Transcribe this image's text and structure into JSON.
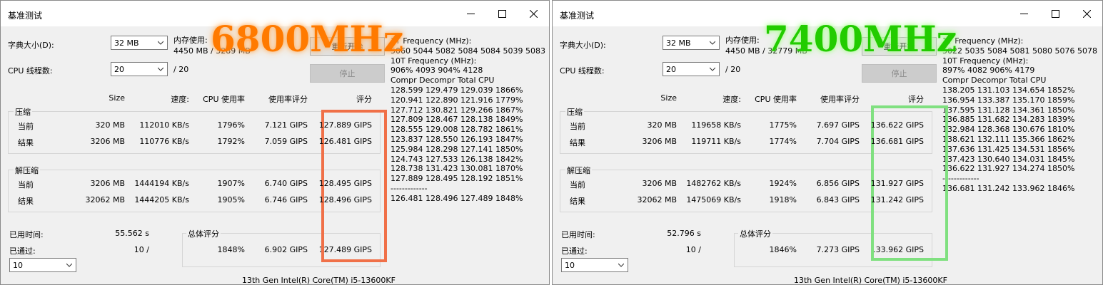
{
  "windows": [
    {
      "title": "基准测试",
      "overlay_text": "6800MHz",
      "overlay_color": "#ff7a00",
      "highlight_color": "#f07048",
      "dict_label": "字典大小(D):",
      "dict_value": "32 MB",
      "threads_label": "CPU 线程数:",
      "threads_value": "20",
      "threads_max": "/ 20",
      "memory_label": "内存使用:",
      "memory_value": "4450 MB / 3289 MB",
      "restart_button": "重新开始",
      "stop_button": "停止",
      "headers": {
        "size": "Size",
        "speed": "速度:",
        "cpu": "CPU 使用率",
        "rating": "使用率评分",
        "score": "评分"
      },
      "compress_label": "压缩",
      "decompress_label": "解压缩",
      "compress_current": {
        "label": "当前",
        "size": "320 MB",
        "speed": "112010 KB/s",
        "cpu": "1796%",
        "rating": "7.121 GIPS",
        "score": "127.889 GIPS"
      },
      "compress_result": {
        "label": "结果",
        "size": "3206 MB",
        "speed": "110776 KB/s",
        "cpu": "1792%",
        "rating": "7.059 GIPS",
        "score": "126.481 GIPS"
      },
      "decompress_current": {
        "label": "当前",
        "size": "3206 MB",
        "speed": "1444194 KB/s",
        "cpu": "1907%",
        "rating": "6.740 GIPS",
        "score": "128.495 GIPS"
      },
      "decompress_result": {
        "label": "结果",
        "size": "32062 MB",
        "speed": "1444205 KB/s",
        "cpu": "1905%",
        "rating": "6.746 GIPS",
        "score": "128.496 GIPS"
      },
      "elapsed_label": "已用时间:",
      "elapsed_value": "55.562 s",
      "passed_label": "已通过:",
      "passed_value": "10 /",
      "passes_select": "10",
      "total_label": "总体评分",
      "total_cpu": "1848%",
      "total_rating": "6.902 GIPS",
      "total_score": "127.489 GIPS",
      "cpu_name": "13th Gen Intel(R) Core(TM) i5-13600KF",
      "log_lines": [
        "1T Frequency (MHz):",
        " 5060 5044 5082 5084 5084 5039 5083",
        "10T Frequency (MHz):",
        " 906% 4093 904% 4128",
        "Compr Decompr Total   CPU",
        "128.599  129.479  129.039  1866%",
        "120.941  122.890  121.916  1779%",
        "127.712  130.821  129.266  1867%",
        "127.809  128.467  128.138  1849%",
        "128.555  129.008  128.782  1861%",
        "123.837  128.550  126.193  1847%",
        "125.984  128.298  127.141  1850%",
        "124.743  127.533  126.138  1842%",
        "128.738  131.423  130.081  1870%",
        "127.889  128.495  128.192  1851%",
        "-------------",
        "126.481  128.496  127.489  1848%"
      ]
    },
    {
      "title": "基准测试",
      "overlay_text": "7400MHz",
      "overlay_color": "#22cc00",
      "highlight_color": "#80e080",
      "dict_label": "字典大小(D):",
      "dict_value": "32 MB",
      "threads_label": "CPU 线程数:",
      "threads_value": "20",
      "threads_max": "/ 20",
      "memory_label": "内存使用:",
      "memory_value": "4450 MB / 32779 MB",
      "restart_button": "重新开始",
      "stop_button": "停止",
      "headers": {
        "size": "Size",
        "speed": "速度:",
        "cpu": "CPU 使用率",
        "rating": "使用率评分",
        "score": "评分"
      },
      "compress_label": "压缩",
      "decompress_label": "解压缩",
      "compress_current": {
        "label": "当前",
        "size": "320 MB",
        "speed": "119658 KB/s",
        "cpu": "1775%",
        "rating": "7.697 GIPS",
        "score": "136.622 GIPS"
      },
      "compress_result": {
        "label": "结果",
        "size": "3206 MB",
        "speed": "119711 KB/s",
        "cpu": "1774%",
        "rating": "7.704 GIPS",
        "score": "136.681 GIPS"
      },
      "decompress_current": {
        "label": "当前",
        "size": "3206 MB",
        "speed": "1482762 KB/s",
        "cpu": "1924%",
        "rating": "6.856 GIPS",
        "score": "131.927 GIPS"
      },
      "decompress_result": {
        "label": "结果",
        "size": "32062 MB",
        "speed": "1475069 KB/s",
        "cpu": "1918%",
        "rating": "6.843 GIPS",
        "score": "131.242 GIPS"
      },
      "elapsed_label": "已用时间:",
      "elapsed_value": "52.796 s",
      "passed_label": "已通过:",
      "passed_value": "10 /",
      "passes_select": "10",
      "total_label": "总体评分",
      "total_cpu": "1846%",
      "total_rating": "7.273 GIPS",
      "total_score": "133.962 GIPS",
      "cpu_name": "13th Gen Intel(R) Core(TM) i5-13600KF",
      "log_lines": [
        "1T Frequency (MHz):",
        " 5022 5035 5084 5081 5080 5076 5078",
        "10T Frequency (MHz):",
        " 897% 4082 906% 4179",
        "Compr Decompr Total   CPU",
        "138.205  131.103  134.654  1852%",
        "136.954  133.387  135.170  1859%",
        "137.595  131.128  134.361  1850%",
        "136.885  131.682  134.283  1839%",
        "132.984  128.368  130.676  1810%",
        "138.621  132.111  135.366  1862%",
        "137.636  131.425  134.531  1856%",
        "137.423  130.640  134.031  1845%",
        "136.622  131.927  134.274  1850%",
        "-------------",
        "136.681  131.242  133.962  1846%"
      ]
    }
  ]
}
